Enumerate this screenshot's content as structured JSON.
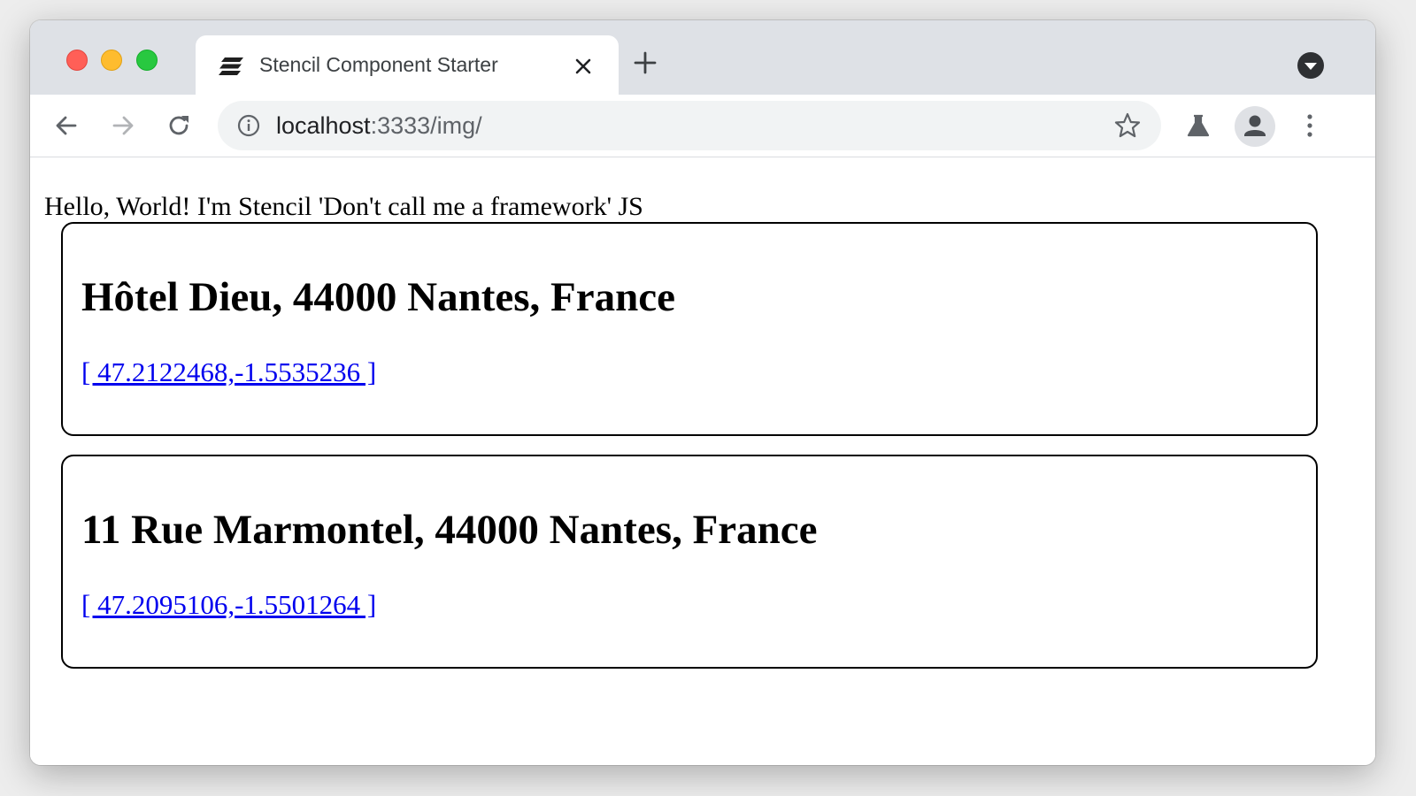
{
  "browser": {
    "tab": {
      "title": "Stencil Component Starter",
      "favicon": "stencil-logo-icon"
    },
    "url": {
      "host": "localhost",
      "path": ":3333/img/"
    },
    "icons": {
      "back": "arrow-left-icon",
      "forward": "arrow-right-icon",
      "reload": "reload-icon",
      "site_info": "info-icon",
      "bookmark": "star-icon",
      "labs": "flask-icon",
      "profile": "person-icon",
      "menu": "kebab-menu-icon",
      "new_tab": "plus-icon",
      "tab_search": "chevron-down-icon",
      "close_tab": "close-icon"
    },
    "colors": {
      "tabstrip": "#dee1e6",
      "omnibox": "#f1f3f4",
      "close": "#ff5f57",
      "minimize": "#febc2e",
      "maximize": "#28c840"
    }
  },
  "page": {
    "greeting": "Hello, World! I'm Stencil 'Don't call me a framework' JS",
    "places": [
      {
        "title": "Hôtel Dieu, 44000 Nantes, France",
        "coords": "[ 47.2122468,-1.5535236 ]"
      },
      {
        "title": "11 Rue Marmontel, 44000 Nantes, France",
        "coords": "[ 47.2095106,-1.5501264 ]"
      }
    ],
    "colors": {
      "link": "#0000ee",
      "card_border": "#000000"
    }
  }
}
